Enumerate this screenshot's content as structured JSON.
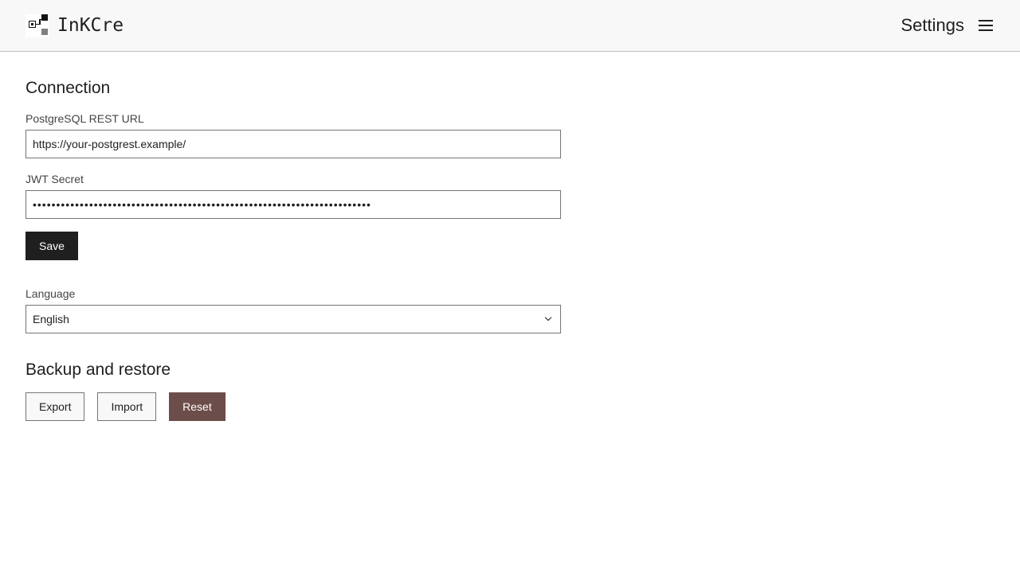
{
  "header": {
    "brand_name": "InKCre",
    "page_title": "Settings",
    "menu_icon": "hamburger-menu-icon",
    "logo_icon": "inkcre-logo-icon"
  },
  "connection": {
    "title": "Connection",
    "url_label": "PostgreSQL REST URL",
    "url_value": "https://your-postgrest.example/",
    "jwt_label": "JWT Secret",
    "jwt_value": "••••••••••••••••••••••••••••••••••••••••••••••••••••••••••••••••••••••••",
    "save_label": "Save"
  },
  "language": {
    "label": "Language",
    "selected": "English",
    "chevron_icon": "chevron-down-icon"
  },
  "backup": {
    "title": "Backup and restore",
    "export_label": "Export",
    "import_label": "Import",
    "reset_label": "Reset"
  },
  "colors": {
    "primary_button": "#1f1f1f",
    "danger_button": "#6d4d4a",
    "header_bg": "#f8f8f8",
    "border": "#757575"
  }
}
